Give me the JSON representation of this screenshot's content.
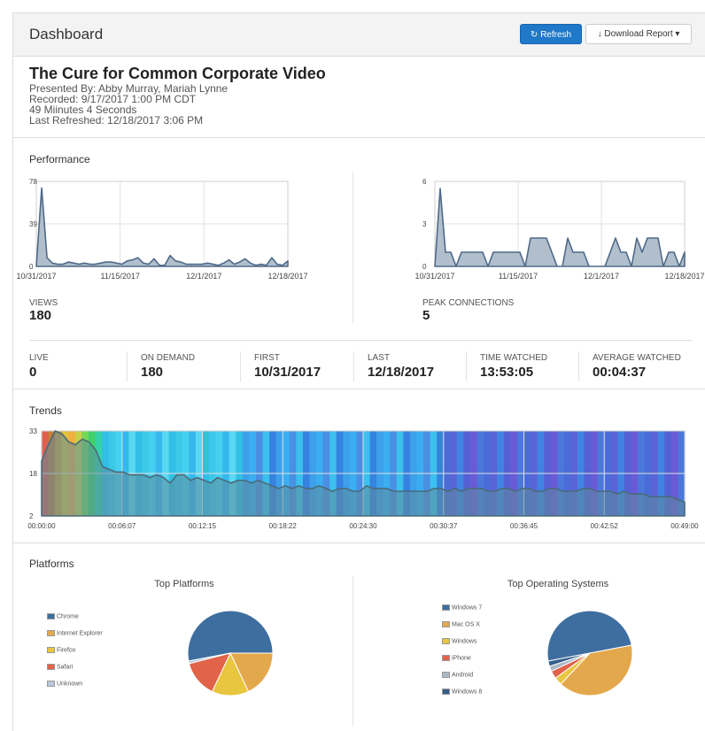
{
  "header": {
    "title": "Dashboard",
    "refresh_label": "Refresh",
    "download_label": "Download Report ▾"
  },
  "event": {
    "title": "The Cure for Common Corporate Video",
    "presenters": "Presented By: Abby Murray, Mariah Lynne",
    "recorded": "Recorded: 9/17/2017 1:00 PM CDT",
    "duration": "49 Miinutes 4 Seconds",
    "last_refreshed": "Last Refreshed: 12/18/2017 3:06 PM"
  },
  "performance": {
    "title": "Performance",
    "views_label": "VIEWS",
    "views_value": "180",
    "peak_label": "PEAK CONNECTIONS",
    "peak_value": "5"
  },
  "stats": [
    {
      "label": "LIVE",
      "value": "0"
    },
    {
      "label": "ON DEMAND",
      "value": "180"
    },
    {
      "label": "FIRST",
      "value": "10/31/2017"
    },
    {
      "label": "LAST",
      "value": "12/18/2017"
    },
    {
      "label": "TIME WATCHED",
      "value": "13:53:05"
    },
    {
      "label": "AVERAGE WATCHED",
      "value": "00:04:37"
    }
  ],
  "trends": {
    "title": "Trends"
  },
  "platforms": {
    "title": "Platforms",
    "left_title": "Top Platforms",
    "right_title": "Top Operating Systems",
    "left_legend": [
      "Chrome",
      "Internet Explorer",
      "Firefox",
      "Safari",
      "Unknown"
    ],
    "right_legend": [
      "Windows 7",
      "Mac OS X",
      "Windows",
      "iPhone",
      "Android",
      "Windows 8"
    ]
  },
  "colors": {
    "accent": "#1f78c8",
    "area_fill": "#a9b8c8",
    "area_line": "#4f6a88"
  },
  "chart_data": [
    {
      "type": "area",
      "ylim": [
        0,
        78
      ],
      "yticks": [
        "78",
        "39",
        "0"
      ],
      "xticks": [
        "10/31/2017",
        "11/15/2017",
        "12/1/2017",
        "12/18/2017"
      ],
      "values": [
        0,
        72,
        8,
        3,
        2,
        2,
        4,
        3,
        2,
        3,
        2,
        2,
        3,
        4,
        4,
        3,
        2,
        5,
        6,
        8,
        3,
        2,
        7,
        1,
        1,
        10,
        5,
        4,
        2,
        2,
        2,
        2,
        3,
        2,
        1,
        3,
        6,
        2,
        4,
        7,
        3,
        1,
        2,
        1,
        8,
        2,
        1,
        5
      ]
    },
    {
      "type": "area",
      "ylim": [
        0,
        6
      ],
      "yticks": [
        "6",
        "3",
        "0"
      ],
      "xticks": [
        "10/31/2017",
        "11/15/2017",
        "12/1/2017",
        "12/18/2017"
      ],
      "values": [
        0,
        5.5,
        1,
        1,
        0,
        1,
        1,
        1,
        1,
        1,
        0,
        1,
        1,
        1,
        1,
        1,
        1,
        0,
        2,
        2,
        2,
        2,
        1,
        0,
        0,
        2,
        1,
        1,
        1,
        0,
        0,
        0,
        0,
        1,
        2,
        1,
        1,
        0,
        2,
        1,
        2,
        2,
        2,
        0,
        1,
        1,
        0,
        1
      ]
    },
    {
      "type": "area",
      "ylim": [
        2,
        33
      ],
      "yticks": [
        "33",
        "18",
        "2"
      ],
      "xticks": [
        "00:00:00",
        "00:06:07",
        "00:12:15",
        "00:18:22",
        "00:24:30",
        "00:30:37",
        "00:36:45",
        "00:42:52",
        "00:49:00"
      ],
      "values": [
        22,
        28,
        33,
        32,
        29,
        28,
        30,
        29,
        26,
        20,
        19,
        18,
        18,
        17,
        17,
        17,
        16,
        17,
        16,
        14,
        17,
        17,
        15,
        16,
        15,
        14,
        16,
        15,
        14,
        15,
        15,
        14,
        15,
        14,
        13,
        12,
        13,
        12,
        13,
        12,
        12,
        13,
        12,
        11,
        12,
        12,
        11,
        11,
        13,
        12,
        12,
        12,
        11,
        11,
        11,
        11,
        11,
        11,
        12,
        12,
        11,
        12,
        11,
        12,
        12,
        12,
        11,
        11,
        12,
        12,
        11,
        12,
        12,
        11,
        11,
        12,
        12,
        11,
        11,
        11,
        12,
        12,
        11,
        11,
        11,
        10,
        11,
        10,
        10,
        10,
        9,
        9,
        9,
        9,
        8,
        7
      ]
    },
    {
      "type": "pie",
      "labels": [
        "Chrome",
        "Internet Explorer",
        "Firefox",
        "Safari",
        "Unknown"
      ],
      "values": [
        53,
        18,
        14,
        14,
        1
      ]
    },
    {
      "type": "pie",
      "labels": [
        "Windows 7",
        "Mac OS X",
        "Windows",
        "iPhone",
        "Android",
        "Windows 8"
      ],
      "values": [
        50,
        40,
        3,
        3,
        2,
        2
      ]
    }
  ]
}
